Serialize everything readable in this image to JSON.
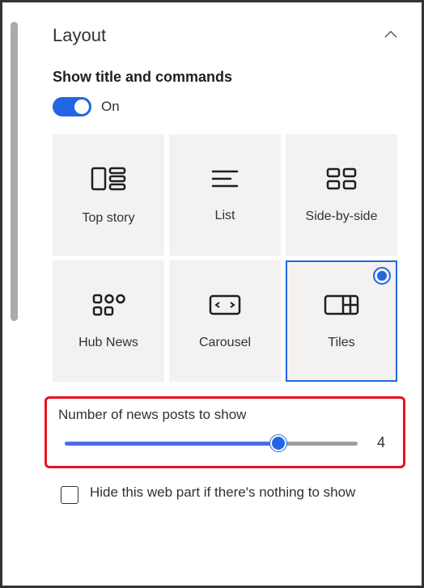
{
  "section_title": "Layout",
  "toggle": {
    "header": "Show title and commands",
    "state_label": "On"
  },
  "layouts": {
    "items": [
      {
        "label": "Top story"
      },
      {
        "label": "List"
      },
      {
        "label": "Side-by-side"
      },
      {
        "label": "Hub News"
      },
      {
        "label": "Carousel"
      },
      {
        "label": "Tiles"
      }
    ]
  },
  "slider": {
    "label": "Number of news posts to show",
    "value": "4"
  },
  "checkbox": {
    "label": "Hide this web part if there's nothing to show"
  }
}
